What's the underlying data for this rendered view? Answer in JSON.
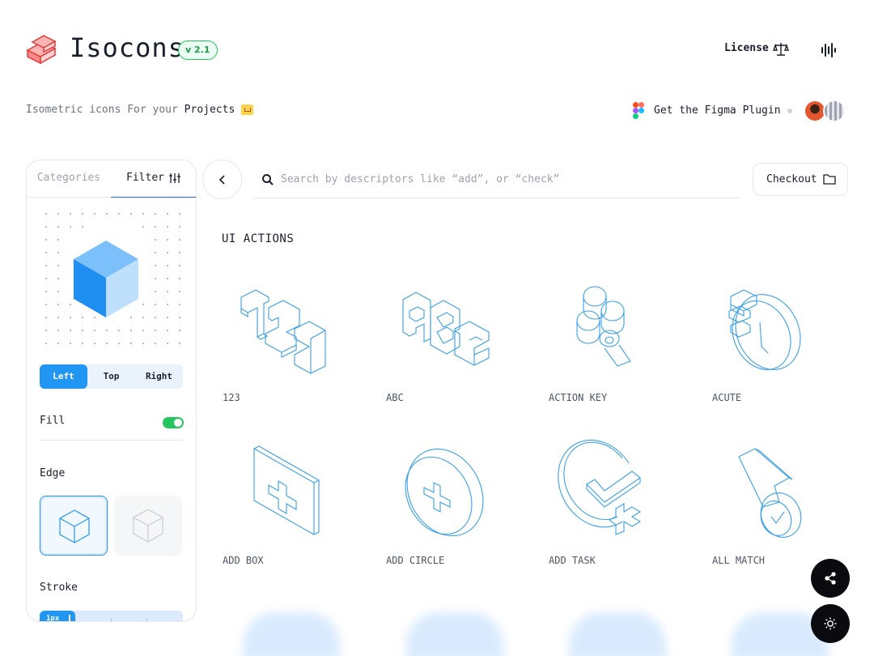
{
  "header": {
    "brand": "Isocons",
    "version": "v 2.1",
    "license_label": "License",
    "tagline_prefix": "Isometric icons For your ",
    "tagline_highlight": "Projects",
    "figma_label": "Get the Figma Plugin"
  },
  "sidebar": {
    "tabs": {
      "categories": "Categories",
      "filter": "Filter"
    },
    "view_options": [
      "Left",
      "Top",
      "Right"
    ],
    "view_selected": "Left",
    "fill_label": "Fill",
    "fill_enabled": true,
    "edge_label": "Edge",
    "stroke_label": "Stroke",
    "stroke_value": "1px"
  },
  "search": {
    "placeholder": "Search by descriptors like “add”, or “check”"
  },
  "checkout_label": "Checkout",
  "section": {
    "title": "UI ACTIONS",
    "icons": [
      {
        "label": "123",
        "icon": "numbers-123-icon"
      },
      {
        "label": "ABC",
        "icon": "letters-abc-icon"
      },
      {
        "label": "ACTION KEY",
        "icon": "action-key-icon"
      },
      {
        "label": "ACUTE",
        "icon": "acute-clock-icon"
      },
      {
        "label": "ADD BOX",
        "icon": "add-box-icon"
      },
      {
        "label": "ADD CIRCLE",
        "icon": "add-circle-icon"
      },
      {
        "label": "ADD TASK",
        "icon": "add-task-icon"
      },
      {
        "label": "ALL MATCH",
        "icon": "all-match-icon"
      }
    ]
  },
  "colors": {
    "accent": "#2196f3",
    "toggle_on": "#22c55e",
    "icon_stroke": "#3aa0e6"
  },
  "fabs": [
    "share-icon",
    "theme-icon"
  ]
}
